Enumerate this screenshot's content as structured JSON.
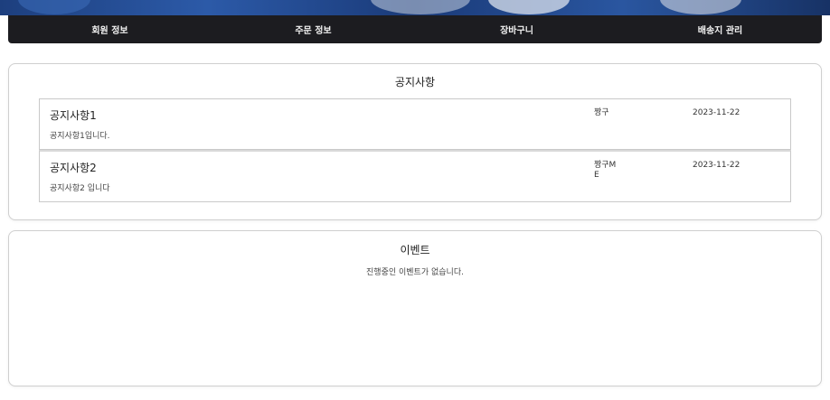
{
  "nav": {
    "items": [
      {
        "label": "회원 정보"
      },
      {
        "label": "주문 정보"
      },
      {
        "label": "장바구니"
      },
      {
        "label": "배송지 관리"
      }
    ]
  },
  "notices": {
    "title": "공지사항",
    "items": [
      {
        "title": "공지사항1",
        "content": "공지사항1입니다.",
        "author": "짱구",
        "date": "2023-11-22"
      },
      {
        "title": "공지사항2",
        "content": "공지사항2 입니다",
        "author": "짱구ME",
        "date": "2023-11-22"
      }
    ]
  },
  "events": {
    "title": "이벤트",
    "empty_message": "진행중인 이벤트가 없습니다."
  },
  "colors": {
    "nav_bg": "#1c1c20",
    "banner": "#2c5aa8",
    "card_border": "#cfcfcf"
  }
}
